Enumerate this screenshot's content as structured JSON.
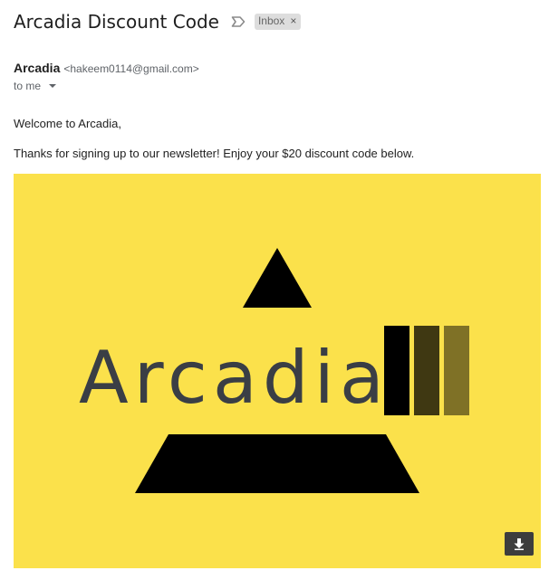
{
  "email": {
    "subject": "Arcadia Discount Code",
    "label": "Inbox",
    "label_remove": "×",
    "sender_name": "Arcadia",
    "sender_email": "<hakeem0114@gmail.com>",
    "recipient": "to me",
    "greeting": "Welcome to Arcadia,",
    "message": "Thanks for signing up to our newsletter! Enjoy your $20 discount code below."
  },
  "banner": {
    "logo_text": "Arcadia",
    "background_color": "#fbe14b",
    "bar_colors": [
      "#000000",
      "#3f3812",
      "#7f7126"
    ]
  },
  "icons": {
    "importance": "importance-marker-icon",
    "recipient_details": "chevron-down-icon",
    "download": "download-icon"
  }
}
